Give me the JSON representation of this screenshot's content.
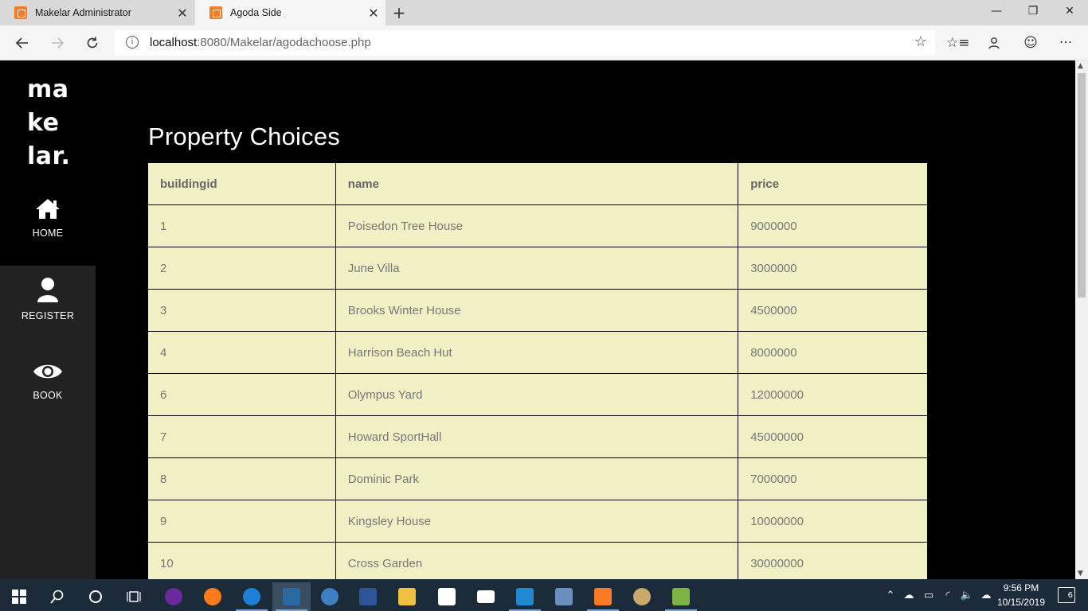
{
  "browser": {
    "tabs": [
      {
        "title": "Makelar Administrator",
        "active": false
      },
      {
        "title": "Agoda Side",
        "active": true
      }
    ],
    "new_tab_symbol": "+",
    "url_host": "localhost",
    "url_rest": ":8080/Makelar/agodachoose.php"
  },
  "sidebar": {
    "logo_lines": [
      "ma",
      "ke",
      "lar."
    ],
    "items": [
      {
        "label": "HOME",
        "icon": "home-icon"
      },
      {
        "label": "REGISTER",
        "icon": "user-icon"
      },
      {
        "label": "BOOK",
        "icon": "eye-icon"
      }
    ]
  },
  "main": {
    "heading": "Property Choices",
    "table": {
      "headers": [
        "buildingid",
        "name",
        "price"
      ],
      "rows": [
        [
          "1",
          "Poisedon Tree House",
          "9000000"
        ],
        [
          "2",
          "June Villa",
          "3000000"
        ],
        [
          "3",
          "Brooks Winter House",
          "4500000"
        ],
        [
          "4",
          "Harrison Beach Hut",
          "8000000"
        ],
        [
          "6",
          "Olympus Yard",
          "12000000"
        ],
        [
          "7",
          "Howard SportHall",
          "45000000"
        ],
        [
          "8",
          "Dominic Park",
          "7000000"
        ],
        [
          "9",
          "Kingsley House",
          "10000000"
        ],
        [
          "10",
          "Cross Garden",
          "30000000"
        ]
      ]
    }
  },
  "taskbar": {
    "time": "9:56 PM",
    "date": "10/15/2019",
    "notification_count": "6"
  },
  "colors": {
    "table_bg": "#f0f0c4",
    "sidebar_dark": "#222222",
    "accent_orange": "#fb7a24"
  }
}
